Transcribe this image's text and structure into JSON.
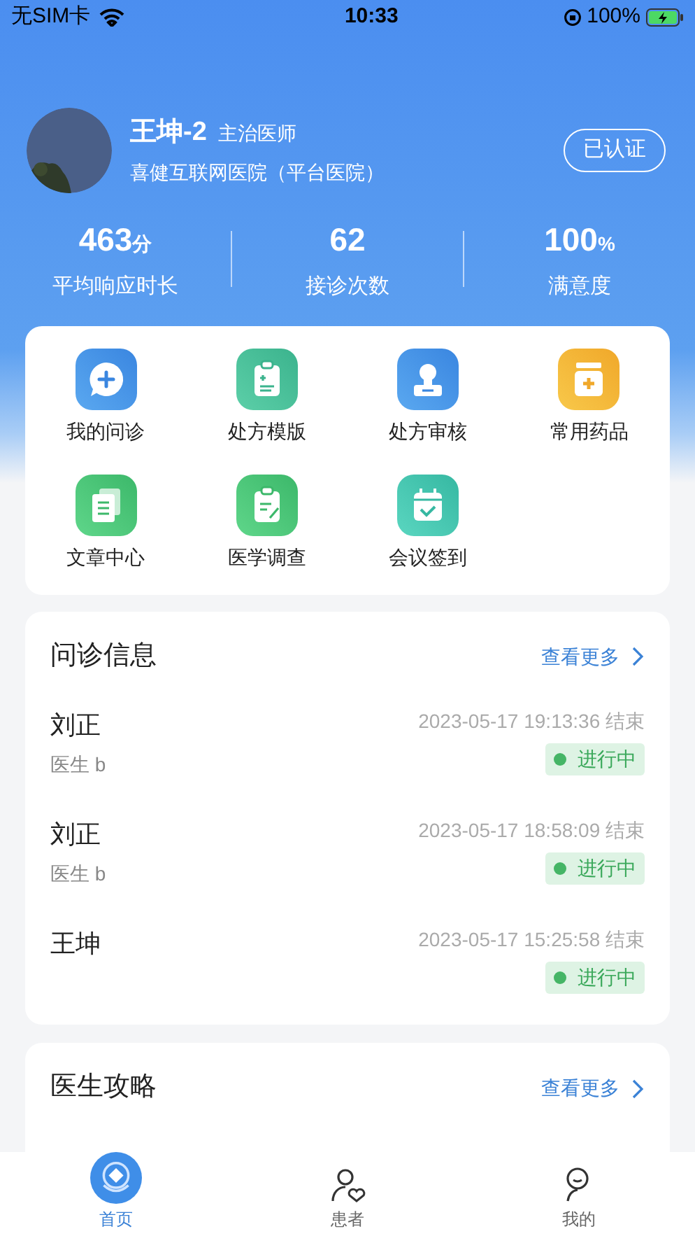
{
  "status_bar": {
    "carrier": "无SIM卡",
    "time": "10:33",
    "battery": "100%"
  },
  "profile": {
    "name": "王坤-2",
    "title": "主治医师",
    "hospital": "喜健互联网医院（平台医院）",
    "badge": "已认证"
  },
  "stats": [
    {
      "value": "463",
      "unit": "分",
      "label": "平均响应时长"
    },
    {
      "value": "62",
      "label": "接诊次数"
    },
    {
      "value": "100",
      "unit": "%",
      "label": "满意度"
    }
  ],
  "shortcuts": [
    {
      "kind": "chat",
      "label": "我的问诊"
    },
    {
      "kind": "clipboard",
      "label": "处方模版"
    },
    {
      "kind": "stamp",
      "label": "处方审核"
    },
    {
      "kind": "medicine",
      "label": "常用药品"
    },
    {
      "kind": "documents",
      "label": "文章中心"
    },
    {
      "kind": "survey",
      "label": "医学调查"
    },
    {
      "kind": "calendar",
      "label": "会议签到"
    }
  ],
  "consultations": {
    "title": "问诊信息",
    "more": "查看更多",
    "rows": [
      {
        "name": "刘正",
        "doctor": "医生 b",
        "time": "2023-05-17 19:13:36 结束",
        "status": "进行中"
      },
      {
        "name": "刘正",
        "doctor": "医生 b",
        "time": "2023-05-17 18:58:09 结束",
        "status": "进行中"
      },
      {
        "name": "王坤",
        "time": "2023-05-17 15:25:58 结束",
        "status": "进行中"
      }
    ]
  },
  "guides": {
    "title": "医生攻略",
    "more": "查看更多"
  },
  "tab_bar": [
    {
      "kind": "home",
      "label": "首页",
      "selected": true
    },
    {
      "kind": "patients",
      "label": "患者",
      "selected": false
    },
    {
      "kind": "me",
      "label": "我的",
      "selected": false
    }
  ]
}
